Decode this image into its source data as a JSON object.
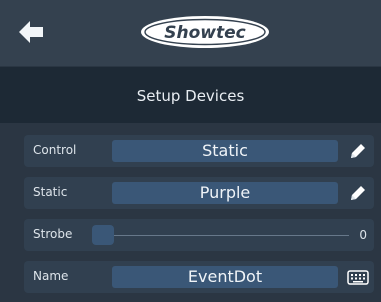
{
  "header": {
    "back_icon": "arrow-left-icon",
    "logo_text": "Showtec",
    "logo_colors": {
      "background": "#ffffff",
      "text": "#34414f"
    }
  },
  "page": {
    "title": "Setup Devices"
  },
  "rows": {
    "control": {
      "label": "Control",
      "value": "Static",
      "icon": "pencil-icon"
    },
    "static": {
      "label": "Static",
      "value": "Purple",
      "icon": "pencil-icon"
    },
    "strobe": {
      "label": "Strobe",
      "value": "0",
      "level": 0
    },
    "name": {
      "label": "Name",
      "value": "EventDot",
      "icon": "keyboard-icon"
    }
  },
  "colors": {
    "topbar": "#34414f",
    "title_bar": "#1d2935",
    "content": "#2b3643",
    "row": "#314050",
    "field": "#3a5777",
    "text": "#e9eef3"
  }
}
